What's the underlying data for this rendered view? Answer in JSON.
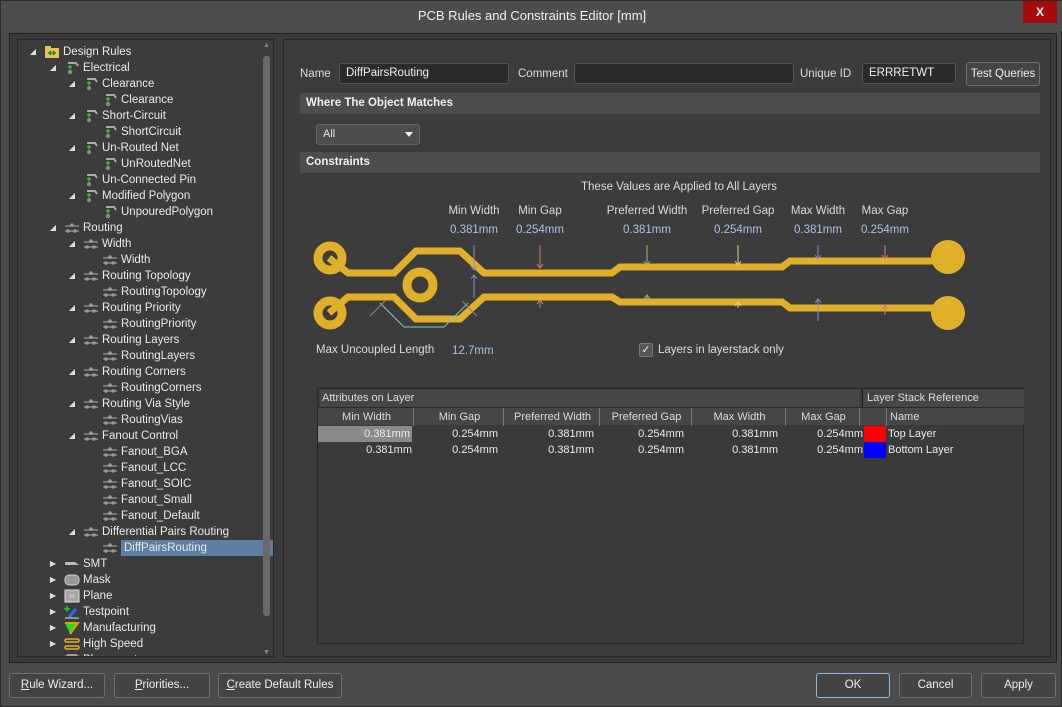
{
  "window": {
    "title": "PCB Rules and Constraints Editor [mm]",
    "close_label": "X"
  },
  "tree": {
    "items": [
      {
        "label": "Design Rules",
        "level": 0,
        "expanded": true,
        "icon": "design-rules-folder-icon"
      },
      {
        "label": "Electrical",
        "level": 1,
        "expanded": true,
        "icon": "electrical-rule-icon"
      },
      {
        "label": "Clearance",
        "level": 2,
        "expanded": true,
        "icon": "electrical-rule-icon"
      },
      {
        "label": "Clearance",
        "level": 3,
        "icon": "electrical-rule-icon"
      },
      {
        "label": "Short-Circuit",
        "level": 2,
        "expanded": true,
        "icon": "electrical-rule-icon"
      },
      {
        "label": "ShortCircuit",
        "level": 3,
        "icon": "electrical-rule-icon"
      },
      {
        "label": "Un-Routed Net",
        "level": 2,
        "expanded": true,
        "icon": "electrical-rule-icon"
      },
      {
        "label": "UnRoutedNet",
        "level": 3,
        "icon": "electrical-rule-icon"
      },
      {
        "label": "Un-Connected Pin",
        "level": 2,
        "icon": "electrical-rule-icon"
      },
      {
        "label": "Modified Polygon",
        "level": 2,
        "expanded": true,
        "icon": "electrical-rule-icon"
      },
      {
        "label": "UnpouredPolygon",
        "level": 3,
        "icon": "electrical-rule-icon"
      },
      {
        "label": "Routing",
        "level": 1,
        "expanded": true,
        "icon": "routing-rule-icon"
      },
      {
        "label": "Width",
        "level": 2,
        "expanded": true,
        "icon": "routing-rule-icon"
      },
      {
        "label": "Width",
        "level": 3,
        "icon": "routing-rule-icon"
      },
      {
        "label": "Routing Topology",
        "level": 2,
        "expanded": true,
        "icon": "routing-rule-icon"
      },
      {
        "label": "RoutingTopology",
        "level": 3,
        "icon": "routing-rule-icon"
      },
      {
        "label": "Routing Priority",
        "level": 2,
        "expanded": true,
        "icon": "routing-rule-icon"
      },
      {
        "label": "RoutingPriority",
        "level": 3,
        "icon": "routing-rule-icon"
      },
      {
        "label": "Routing Layers",
        "level": 2,
        "expanded": true,
        "icon": "routing-rule-icon"
      },
      {
        "label": "RoutingLayers",
        "level": 3,
        "icon": "routing-rule-icon"
      },
      {
        "label": "Routing Corners",
        "level": 2,
        "expanded": true,
        "icon": "routing-rule-icon"
      },
      {
        "label": "RoutingCorners",
        "level": 3,
        "icon": "routing-rule-icon"
      },
      {
        "label": "Routing Via Style",
        "level": 2,
        "expanded": true,
        "icon": "routing-rule-icon"
      },
      {
        "label": "RoutingVias",
        "level": 3,
        "icon": "routing-rule-icon"
      },
      {
        "label": "Fanout Control",
        "level": 2,
        "expanded": true,
        "icon": "routing-rule-icon"
      },
      {
        "label": "Fanout_BGA",
        "level": 3,
        "icon": "routing-rule-icon"
      },
      {
        "label": "Fanout_LCC",
        "level": 3,
        "icon": "routing-rule-icon"
      },
      {
        "label": "Fanout_SOIC",
        "level": 3,
        "icon": "routing-rule-icon"
      },
      {
        "label": "Fanout_Small",
        "level": 3,
        "icon": "routing-rule-icon"
      },
      {
        "label": "Fanout_Default",
        "level": 3,
        "icon": "routing-rule-icon"
      },
      {
        "label": "Differential Pairs Routing",
        "level": 2,
        "expanded": true,
        "icon": "routing-rule-icon"
      },
      {
        "label": "DiffPairsRouting",
        "level": 3,
        "icon": "routing-rule-icon",
        "selected": true
      },
      {
        "label": "SMT",
        "level": 1,
        "expanded": false,
        "icon": "smt-rule-icon"
      },
      {
        "label": "Mask",
        "level": 1,
        "expanded": false,
        "icon": "mask-rule-icon"
      },
      {
        "label": "Plane",
        "level": 1,
        "expanded": false,
        "icon": "plane-rule-icon"
      },
      {
        "label": "Testpoint",
        "level": 1,
        "expanded": false,
        "icon": "testpoint-rule-icon"
      },
      {
        "label": "Manufacturing",
        "level": 1,
        "expanded": false,
        "icon": "manufacturing-rule-icon"
      },
      {
        "label": "High Speed",
        "level": 1,
        "expanded": false,
        "icon": "high-speed-rule-icon"
      },
      {
        "label": "Placement",
        "level": 1,
        "expanded": false,
        "icon": "placement-rule-icon"
      }
    ]
  },
  "rule": {
    "name_label": "Name",
    "name_value": "DiffPairsRouting",
    "comment_label": "Comment",
    "comment_value": "",
    "uid_label": "Unique ID",
    "uid_value": "ERRRETWT",
    "test_queries_label": "Test Queries"
  },
  "where": {
    "title": "Where The Object Matches",
    "selected": "All"
  },
  "constraints": {
    "title": "Constraints",
    "applied_text": "These Values are Applied to All Layers",
    "params": [
      {
        "label": "Min Width",
        "value": "0.381mm"
      },
      {
        "label": "Min Gap",
        "value": "0.254mm"
      },
      {
        "label": "Preferred Width",
        "value": "0.381mm"
      },
      {
        "label": "Preferred Gap",
        "value": "0.254mm"
      },
      {
        "label": "Max Width",
        "value": "0.381mm"
      },
      {
        "label": "Max Gap",
        "value": "0.254mm"
      }
    ],
    "max_uncoupled_label": "Max Uncoupled Length",
    "max_uncoupled_value": "12.7mm",
    "layerstack_only_label": "Layers in layerstack only",
    "layerstack_only_checked": true,
    "trace_color": "#e0b128"
  },
  "grid": {
    "title": "Attributes on Layer",
    "ref_title": "Layer Stack Reference",
    "columns": [
      "Min Width",
      "Min Gap",
      "Preferred Width",
      "Preferred Gap",
      "Max Width",
      "Max Gap"
    ],
    "name_col": "Name",
    "rows": [
      {
        "values": [
          "0.381mm",
          "0.254mm",
          "0.381mm",
          "0.254mm",
          "0.381mm",
          "0.254mm"
        ],
        "layer": "Top Layer",
        "color": "#ff0000"
      },
      {
        "values": [
          "0.381mm",
          "0.254mm",
          "0.381mm",
          "0.254mm",
          "0.381mm",
          "0.254mm"
        ],
        "layer": "Bottom Layer",
        "color": "#0000ff"
      }
    ]
  },
  "footer": {
    "rule_wizard": "Rule Wizard...",
    "priorities": "Priorities...",
    "create_default": "Create Default Rules",
    "ok": "OK",
    "cancel": "Cancel",
    "apply": "Apply"
  }
}
